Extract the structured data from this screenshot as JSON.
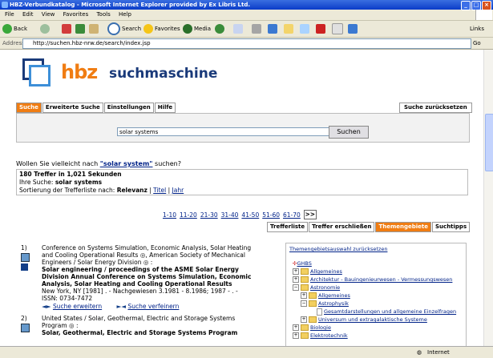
{
  "window": {
    "title": "HBZ-Verbundkatalog - Microsoft Internet Explorer provided by Ex Libris Ltd."
  },
  "menu": [
    "File",
    "Edit",
    "View",
    "Favorites",
    "Tools",
    "Help"
  ],
  "toolbar": {
    "back": "Back",
    "search": "Search",
    "favorites": "Favorites",
    "media": "Media",
    "links": "Links"
  },
  "address": {
    "label": "Address",
    "url": "http://suchen.hbz-nrw.de/search/index.jsp",
    "go": "Go"
  },
  "logo": {
    "brand": "hbz",
    "subtitle": "suchmaschine"
  },
  "tabs": [
    "Suche",
    "Erweiterte Suche",
    "Einstellungen",
    "Hilfe"
  ],
  "reset_label": "Suche zurücksetzen",
  "search": {
    "query": "solar systems",
    "button": "Suchen"
  },
  "suggest": {
    "prefix": "Wollen Sie vielleicht nach ",
    "term": "\"solar system\"",
    "suffix": " suchen?"
  },
  "info": {
    "hits": "180 Treffer in 1,021 Sekunden",
    "query_label": "Ihre Suche:",
    "query": "solar systems",
    "sort_label": "Sortierung der Trefferliste nach:",
    "sort_active": "Relevanz",
    "sort_title": "Titel",
    "sort_year": "Jahr"
  },
  "pager": {
    "pages": [
      "1-10",
      "11-20",
      "21-30",
      "31-40",
      "41-50",
      "51-60",
      "61-70"
    ],
    "next": ">>"
  },
  "result_tabs": [
    "Trefferliste",
    "Treffer erschließen",
    "Themengebiete",
    "Suchtipps"
  ],
  "results": [
    {
      "num": "1)",
      "line1": "Conference on Systems Simulation, Economic Analysis, Solar Heating",
      "line2": "and Cooling Operational Results",
      "line2b": ", American Society of Mechanical",
      "line3": "Engineers / Solar Energy Division",
      "line3b": ":",
      "title1": "Solar engineering / proceedings of the ASME Solar Energy",
      "title2": "Division Annual Conference on Systems Simulation, Economic",
      "title3": "Analysis, Solar Heating and Cooling Operational Results",
      "pub": "New York, NY [1981] . - Nachgewiesen 3.1981 - 8.1986; 1987 - . -",
      "issn": "ISSN: 0734-7472",
      "link1": "Suche erweitern",
      "link2": "Suche verfeinern"
    },
    {
      "num": "2)",
      "line1": "United States / Solar, Geothermal, Electric and Storage Systems",
      "line2": "Program",
      "line3b": ":",
      "title1": "Solar, Geothermal, Electric and Storage Systems Program"
    }
  ],
  "themen": {
    "back": "Themengebietsauswahl zurücksetzen",
    "root": "GHBS",
    "nodes": [
      {
        "label": "Allgemeines",
        "level": 1,
        "pm": "+"
      },
      {
        "label": "Architektur - Bauingenieurwesen - Vermessungswesen",
        "level": 1,
        "pm": "+"
      },
      {
        "label": "Astronomie",
        "level": 1,
        "pm": "−"
      },
      {
        "label": "Allgemeines",
        "level": 2,
        "pm": "+"
      },
      {
        "label": "Astrophysik",
        "level": 2,
        "pm": "−"
      },
      {
        "label": "Gesamtdarstellungen und allgemeine Einzelfragen",
        "level": 3,
        "pm": ""
      },
      {
        "label": "Universum und extragalaktische Systeme",
        "level": 2,
        "pm": "+"
      },
      {
        "label": "Biologie",
        "level": 1,
        "pm": "+"
      },
      {
        "label": "Elektrotechnik",
        "level": 1,
        "pm": "+"
      }
    ]
  },
  "status": {
    "zone": "Internet"
  }
}
